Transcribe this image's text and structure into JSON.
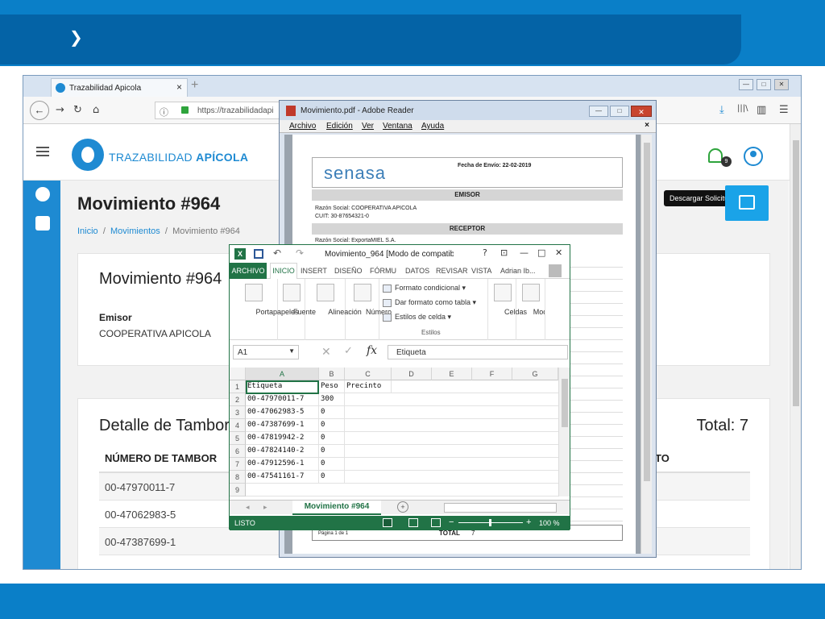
{
  "banner": {
    "chevron": "❯"
  },
  "browser": {
    "tab_title": "Trazabilidad Apicola",
    "tab_close": "×",
    "new_tab": "+",
    "url": "https://trazabilidadapi",
    "nav_icons": {
      "back": "←",
      "forward": "→",
      "reload": "↻",
      "home": "⌂",
      "download": "⤓",
      "library": "|||\\",
      "sidebar": "▥",
      "menu": "☰"
    },
    "window_buttons": [
      "—",
      "□",
      "✕"
    ]
  },
  "app": {
    "logo_prefix": "TRAZABILIDAD ",
    "logo_bold": "APÍCOLA",
    "bell_badge": "9",
    "page_title": "Movimiento #964",
    "breadcrumb": {
      "home": "Inicio",
      "sep": "/",
      "section": "Movimientos",
      "current": "Movimiento #964"
    },
    "card1": {
      "title": "Movimiento #964",
      "emisor_label": "Emisor",
      "emisor_value": "COOPERATIVA APICOLA"
    },
    "card2": {
      "title": "Detalle de Tambores",
      "total": "Total: 7",
      "col_numero": "NÚMERO DE TAMBOR",
      "col_right": "TO",
      "rows": [
        "00-47970011-7",
        "00-47062983-5",
        "00-47387699-1"
      ]
    },
    "download_tooltip": "Descargar Solicitud"
  },
  "adobe": {
    "title": "Movimiento.pdf - Adobe Reader",
    "menu": [
      "Archivo",
      "Edición",
      "Ver",
      "Ventana",
      "Ayuda"
    ],
    "close_x": "✕",
    "menu_x": "×",
    "pdf": {
      "logo": "senasa",
      "fecha": "Fecha de Envío: 22-02-2019",
      "emisor_band": "EMISOR",
      "emisor_razon": "Razón Social:  COOPERATIVA APICOLA",
      "emisor_cuit": "CUIT:  30-87654321-0",
      "receptor_band": "RECEPTOR",
      "receptor_razon": "Razón Social:  ExportaMIEL S.A.",
      "page_label": "Página 1 de 1",
      "total_label": "TOTAL",
      "total_value": "7"
    }
  },
  "excel": {
    "title": "Movimiento_964  [Modo de compatibi...",
    "title_buttons": [
      "?",
      "⊡",
      "—",
      "□",
      "✕"
    ],
    "tabs": [
      "ARCHIVO",
      "INICIO",
      "INSERT",
      "DISEÑO",
      "FÓRMU",
      "DATOS",
      "REVISAR",
      "VISTA",
      "Adrian Ib..."
    ],
    "ribbon": {
      "portapapeles": "Portapapeles",
      "fuente": "Fuente",
      "alineacion": "Alineación",
      "numero": "Número",
      "formato_condicional": "Formato condicional",
      "dar_formato": "Dar formato como tabla",
      "estilos_celda": "Estilos de celda",
      "estilos": "Estilos",
      "celdas": "Celdas",
      "modificar": "Modific"
    },
    "name_box": "A1",
    "formula": "Etiqueta",
    "fx": "fx",
    "columns": [
      "A",
      "B",
      "C",
      "D",
      "E",
      "F",
      "G"
    ],
    "row_numbers": [
      "1",
      "2",
      "3",
      "4",
      "5",
      "6",
      "7",
      "8",
      "9"
    ],
    "rows": [
      [
        "Etiqueta",
        "Peso",
        "Precinto"
      ],
      [
        "00-47970011-7",
        "300",
        ""
      ],
      [
        "00-47062983-5",
        "0",
        ""
      ],
      [
        "00-47387699-1",
        "0",
        ""
      ],
      [
        "00-47819942-2",
        "0",
        ""
      ],
      [
        "00-47824140-2",
        "0",
        ""
      ],
      [
        "00-47912596-1",
        "0",
        ""
      ],
      [
        "00-47541161-7",
        "0",
        ""
      ],
      [
        "",
        "",
        ""
      ]
    ],
    "sheet_tab": "Movimiento #964",
    "add_sheet": "+",
    "status": "LISTO",
    "zoom_minus": "−",
    "zoom_plus": "+",
    "zoom": "100 %"
  }
}
